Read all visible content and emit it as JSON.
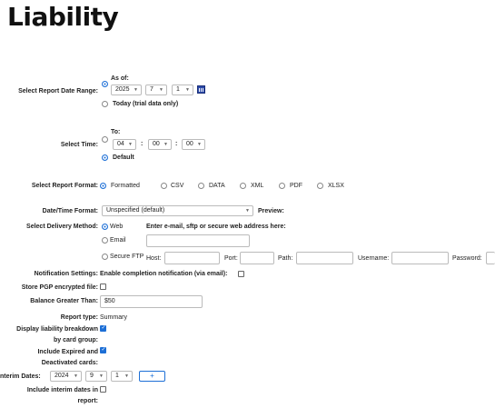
{
  "page": {
    "title": "Liability"
  },
  "date_range": {
    "label": "Select Report Date Range:",
    "as_of_label": "As of:",
    "year": "2025",
    "month": "7",
    "day": "1",
    "today_label": "Today (trial data only)"
  },
  "time": {
    "label": "Select Time:",
    "to_label": "To:",
    "hour": "04",
    "minute": "00",
    "second": "00",
    "sep": ":",
    "default_label": "Default"
  },
  "format": {
    "label": "Select Report Format:",
    "options": [
      "Formatted",
      "CSV",
      "DATA",
      "XML",
      "PDF",
      "XLSX"
    ],
    "selected": "Formatted"
  },
  "datetime_format": {
    "label": "Date/Time Format:",
    "value": "Unspecified (default)",
    "preview_label": "Preview:"
  },
  "delivery": {
    "label": "Select Delivery Method:",
    "web_label": "Web",
    "email_label": "Email",
    "sftp_label": "Secure FTP",
    "address_prompt": "Enter e-mail, sftp or secure web address here:",
    "host_label": "Host:",
    "port_label": "Port:",
    "path_label": "Path:",
    "username_label": "Username:",
    "password_label": "Password:"
  },
  "notification": {
    "label": "Notification Settings:",
    "text": "Enable completion notification (via email):"
  },
  "pgp": {
    "label": "Store PGP encrypted file:"
  },
  "balance": {
    "label": "Balance Greater Than:",
    "value": "$50"
  },
  "report_type": {
    "label": "Report type:",
    "value": "Summary"
  },
  "breakdown": {
    "label_line1": "Display liability breakdown",
    "label_line2": "by card group:"
  },
  "expired": {
    "label_line1": "Include Expired and",
    "label_line2": "Deactivated cards:"
  },
  "interim_dates": {
    "label": "nterim Dates:",
    "year": "2024",
    "month": "9",
    "day": "1",
    "add_label": "+"
  },
  "include_interim": {
    "label_line1": "Include interim dates in",
    "label_line2": "report:"
  }
}
